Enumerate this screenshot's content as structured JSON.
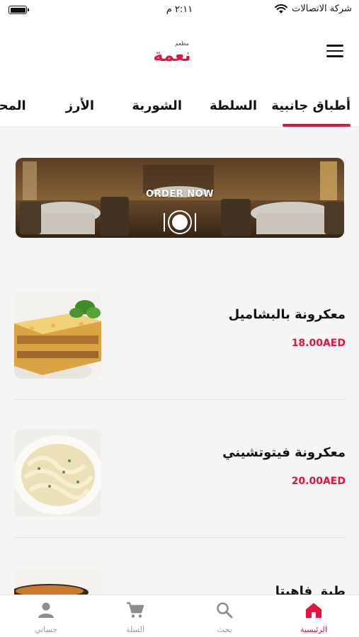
{
  "status_bar": {
    "time": "٢:١١ م",
    "carrier": "شركة الاتصالات"
  },
  "header": {
    "logo_text": "نعمة",
    "logo_subtext": "مطعم"
  },
  "tabs": [
    {
      "label": "أطباق جانبية",
      "active": true
    },
    {
      "label": "السلطة",
      "active": false
    },
    {
      "label": "الشوربة",
      "active": false
    },
    {
      "label": "الأرز",
      "active": false
    },
    {
      "label": "المحا",
      "active": false
    }
  ],
  "banner": {
    "label": "ORDER NOW"
  },
  "products": [
    {
      "name": "معكرونة بالبشاميل",
      "price": "18.00AED"
    },
    {
      "name": "معكرونة فيتوتشيني",
      "price": "20.00AED"
    },
    {
      "name": "طبق فاهيتا",
      "price": ""
    }
  ],
  "bottom_nav": [
    {
      "label": "الرئيسية",
      "icon": "home-icon",
      "active": true
    },
    {
      "label": "بحث",
      "icon": "search-icon",
      "active": false
    },
    {
      "label": "السلة",
      "icon": "cart-icon",
      "active": false
    },
    {
      "label": "حسابي",
      "icon": "account-icon",
      "active": false
    }
  ],
  "colors": {
    "accent": "#e8123f",
    "inactive": "#9a9a9a",
    "background": "#f5f5f5"
  }
}
